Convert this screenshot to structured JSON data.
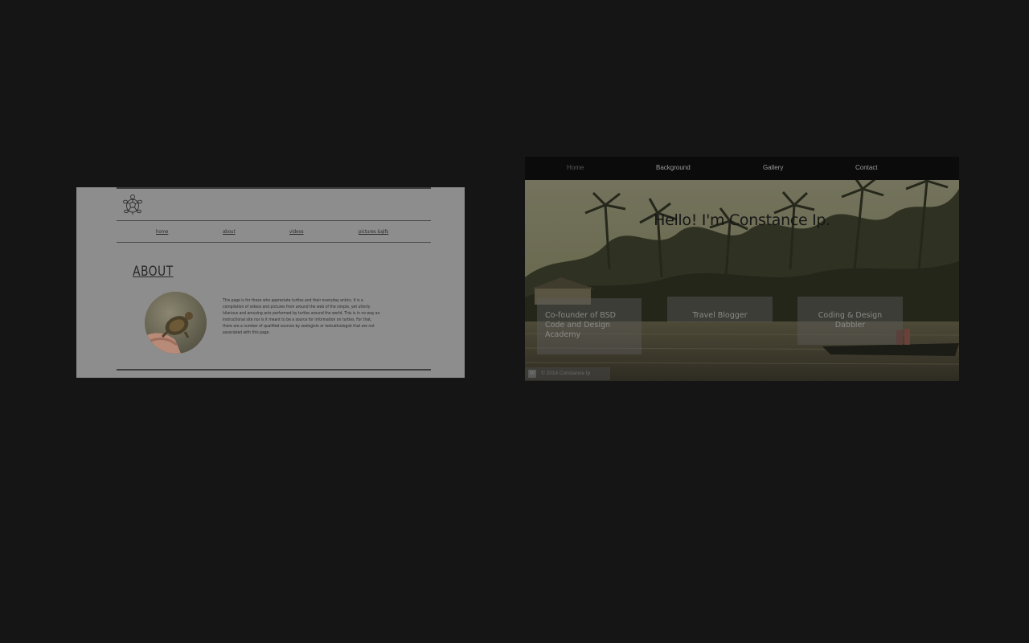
{
  "turtle_page": {
    "nav": [
      {
        "label": "home"
      },
      {
        "label": "about"
      },
      {
        "label": "videos"
      },
      {
        "label": "pictures &gifs"
      }
    ],
    "heading": "ABOUT",
    "paragraph": "This page is for those who appreciate turtles and their everyday antics. It is a compilation of videos and pictures from around the web of the simple, yet utterly hilarious and amusing acts performed by turtles around the world. This is in no way an instructional site nor is it meant to be a source for information on turtles. For that, there are a number of qualified sources by zoologists or testudinologist that are not associated with this page.",
    "logo_icon": "turtle-icon",
    "photo_icon": "turtle-photo"
  },
  "constance_page": {
    "nav": [
      {
        "label": "Home"
      },
      {
        "label": "Background"
      },
      {
        "label": "Gallery"
      },
      {
        "label": "Contact"
      }
    ],
    "headline": "Hello! I'm Constance Ip.",
    "boxes": [
      {
        "label": "Co-founder of BSD Code and Design Academy"
      },
      {
        "label": "Travel Blogger"
      },
      {
        "label": "Coding & Design Dabbler"
      }
    ],
    "footer": {
      "icon_label": "W",
      "copyright": "© 2014 Constance Ip"
    },
    "background_image": "river-palm-trees-photo"
  }
}
